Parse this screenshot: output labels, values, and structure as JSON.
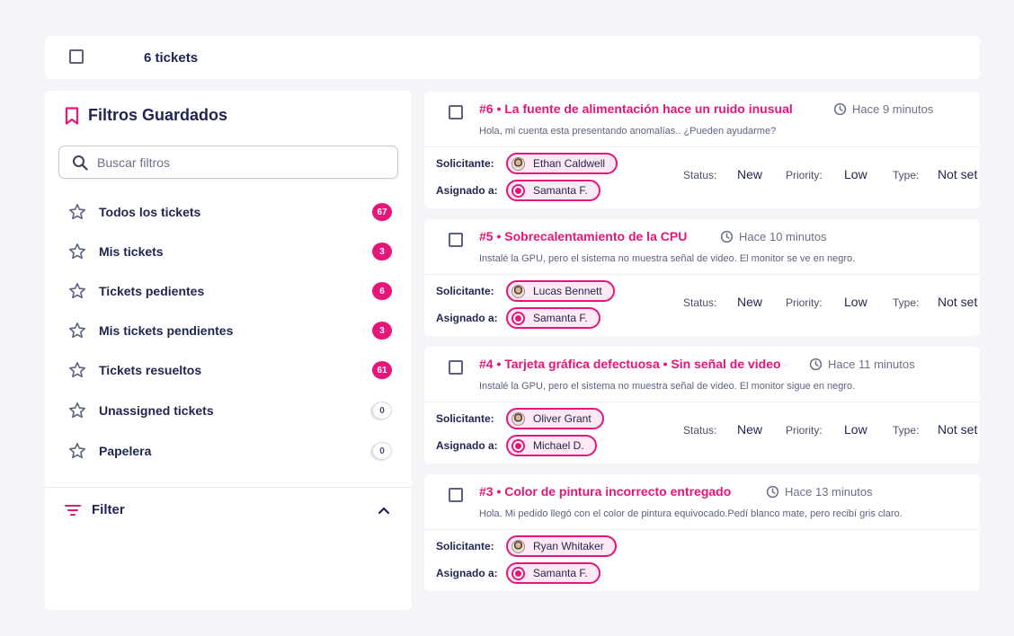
{
  "topbar": {
    "count_label": "6 tickets"
  },
  "sidebar": {
    "title": "Filtros Guardados",
    "search_placeholder": "Buscar filtros",
    "items": [
      {
        "label": "Todos los tickets",
        "count": "67",
        "zero": false
      },
      {
        "label": "Mis tickets",
        "count": "3",
        "zero": false
      },
      {
        "label": "Tickets pedientes",
        "count": "6",
        "zero": false
      },
      {
        "label": "Mis tickets pendientes",
        "count": "3",
        "zero": false
      },
      {
        "label": "Tickets resueltos",
        "count": "61",
        "zero": false
      },
      {
        "label": "Unassigned tickets",
        "count": "0",
        "zero": true
      },
      {
        "label": "Papelera",
        "count": "0",
        "zero": true
      }
    ],
    "filter_label": "Filter"
  },
  "labels": {
    "requester": "Solicitante:",
    "assignee": "Asignado a:",
    "status": "Status:",
    "priority": "Priority:",
    "type": "Type:"
  },
  "tickets": [
    {
      "title": "#6  •  La fuente de alimentación hace un ruido inusual",
      "time": "Hace 9 minutos",
      "description": "Hola, mi cuenta esta presentando anomalías.. ¿Pueden ayudarme?",
      "requester": "Ethan Caldwell",
      "assignee": "Samanta F.",
      "status": "New",
      "priority": "Low",
      "type": "Not set"
    },
    {
      "title": "#5  •  Sobrecalentamiento de la CPU",
      "time": "Hace 10 minutos",
      "description": "Instalé la GPU, pero el sistema no muestra señal de video. El monitor se ve en negro.",
      "requester": "Lucas Bennett",
      "assignee": "Samanta F.",
      "status": "New",
      "priority": "Low",
      "type": "Not set"
    },
    {
      "title": "#4  •  Tarjeta gráfica defectuosa • Sin señal de video",
      "time": "Hace 11 minutos",
      "description": "Instalé la GPU, pero el sistema no muestra señal de video. El monitor sigue en negro.",
      "requester": "Oliver Grant",
      "assignee": "Michael D.",
      "status": "New",
      "priority": "Low",
      "type": "Not set"
    },
    {
      "title": "#3  •  Color de pintura incorrecto entregado",
      "time": "Hace 13 minutos",
      "description": "Hola. Mi pedido llegó con el color de pintura equivocado.Pedí blanco mate, pero recibí gris claro.",
      "requester": "Ryan Whitaker",
      "assignee": "Samanta F.",
      "status": "",
      "priority": "",
      "type": ""
    }
  ],
  "colors": {
    "accent": "#e6157a",
    "text": "#1f2550",
    "background": "#f4f5f9"
  },
  "icons": [
    "checkbox-icon",
    "bookmark-icon",
    "search-icon",
    "star-icon",
    "filter-icon",
    "chevron-up-icon",
    "clock-icon",
    "avatar-icon",
    "agent-icon"
  ]
}
